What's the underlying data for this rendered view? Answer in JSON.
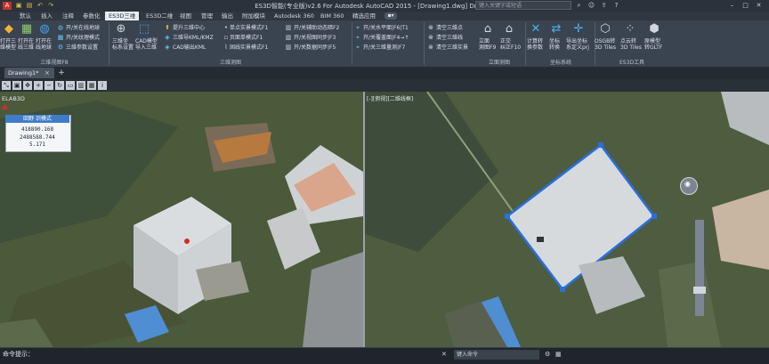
{
  "window": {
    "title": "ES3D智能(专业版)v2.6 For Autodesk AutoCAD 2015 - [Drawing1.dwg]    Drawing1.dwg",
    "search_placeholder": "键入关键字或短语",
    "quick_access_icon": "folder-icon"
  },
  "menu_tabs": [
    "默认",
    "插入",
    "注释",
    "参数化",
    "ES3D三维",
    "ES3D二维",
    "视图",
    "管理",
    "输出",
    "附加模块",
    "Autodesk 360",
    "BIM 360",
    "精选应用"
  ],
  "ribbon": {
    "big_buttons": [
      {
        "label1": "打开三",
        "label2": "维模型"
      },
      {
        "label1": "打开在",
        "label2": "线三维"
      },
      {
        "label1": "打开在",
        "label2": "线地球"
      }
    ],
    "col1": [
      "开/关在线地球",
      "开/关纹理模式",
      "三维参数设置"
    ],
    "group1_label": "三维视图F8",
    "big2": [
      {
        "label1": "三维坐",
        "label2": "标系设置"
      },
      {
        "label1": "CAD模型",
        "label2": "导入三维"
      }
    ],
    "col2": [
      "提升三维中心",
      "三维导KML/KMZ",
      "CAD输出KML"
    ],
    "col3": [
      "单点实景模式F1",
      "页面单模式F1",
      "固线实景模式F1"
    ],
    "col4": [
      "开/关辅助动态暗F2",
      "开/关视图同步|F3",
      "开/关数据同步|F5"
    ],
    "group2_label": "三维测图",
    "col5": [
      "开/关水平面|F6|T1",
      "开/关覆盖面|F4→↑",
      "开/关三维量测|F7"
    ],
    "col6": [
      "清空三维点",
      "清空三维线",
      "清空三维实景"
    ],
    "big3": [
      {
        "label1": "立面",
        "label2": "测图F9"
      },
      {
        "label1": "正交",
        "label2": "纠正F10"
      }
    ],
    "group3_label": "立面测图",
    "big4": [
      {
        "label1": "计算转",
        "label2": "换参数"
      },
      {
        "label1": "坐标",
        "label2": "转换"
      },
      {
        "label1": "导出坐标",
        "label2": "系定义prj"
      }
    ],
    "group4_label": "坐标系统",
    "big5": [
      {
        "label1": "OSGB转",
        "label2": "3D Tiles"
      },
      {
        "label1": "点云转",
        "label2": "3D Tiles"
      },
      {
        "label1": "原模型",
        "label2": "转GLTF"
      }
    ],
    "group5_label": "ES3D工具"
  },
  "document_tab": "Drawing1*",
  "viewport_left_label": "ELAB3D",
  "viewport_right_label": "[-][俯视][二维线框]",
  "coordinate_panel": {
    "title": "田野 识模式",
    "x": "418890.168",
    "y": "2488588.744",
    "z": "5.171"
  },
  "command_prompt": "命令提示：",
  "status_field_placeholder": "键入命令",
  "colors": {
    "ribbon_bg": "#3a4350",
    "active_tab_bg": "#e8edf2",
    "selection_blue": "#2a6fe0",
    "coord_title_bg": "#3e7cc9"
  }
}
